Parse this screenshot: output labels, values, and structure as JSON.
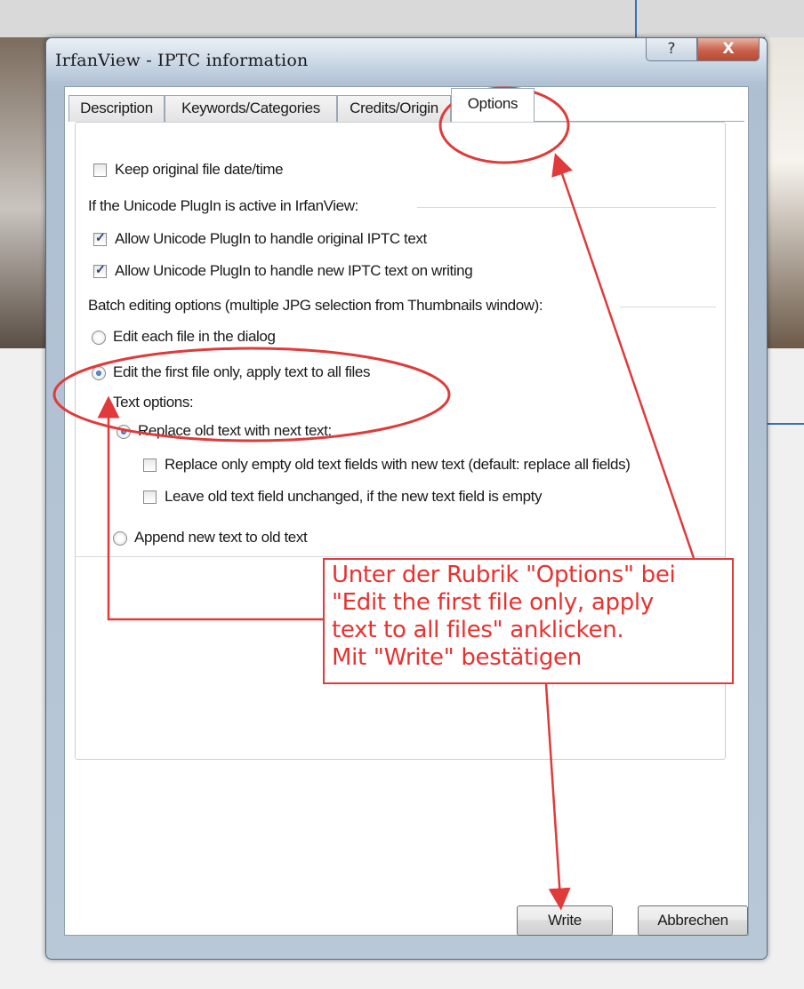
{
  "window": {
    "title": "IrfanView - IPTC information",
    "help_label": "?",
    "close_label": "X"
  },
  "tabs": [
    {
      "label": "Description"
    },
    {
      "label": "Keywords/Categories"
    },
    {
      "label": "Credits/Origin"
    },
    {
      "label": "Options",
      "active": true
    }
  ],
  "options": {
    "keep_date": {
      "label": "Keep original file date/time",
      "checked": false
    },
    "unicode_header": "If the Unicode PlugIn is active in IrfanView:",
    "unicode_original": {
      "label": "Allow Unicode PlugIn to handle original IPTC text",
      "checked": true
    },
    "unicode_new": {
      "label": "Allow Unicode PlugIn to handle new IPTC text on writing",
      "checked": true
    },
    "batch_header": "Batch editing options (multiple JPG selection from Thumbnails window):",
    "edit_each": {
      "label": "Edit each file in the dialog",
      "checked": false
    },
    "edit_first": {
      "label": "Edit the first file only, apply text to all files",
      "checked": true
    },
    "text_options_label": "Text options:",
    "replace_old": {
      "label": "Replace old text with next text:",
      "checked": true
    },
    "replace_empty": {
      "label": "Replace only empty old text fields with new text (default: replace all fields)",
      "checked": false
    },
    "leave_unchanged": {
      "label": "Leave old text field unchanged, if the new text field is empty",
      "checked": false
    },
    "append": {
      "label": "Append new text to old text",
      "checked": false
    }
  },
  "buttons": {
    "write": "Write",
    "cancel": "Abbrechen"
  },
  "annotation": {
    "lines": [
      "Unter der Rubrik \"Options\" bei",
      "\"Edit the first file only, apply",
      "text to all files\" anklicken.",
      "Mit \"Write\" bestätigen"
    ],
    "color": "#e8322f"
  },
  "colors": {
    "accent_red": "#e03a3a",
    "window_frame": "#b6c8db",
    "desktop_line": "#3b6fb3"
  }
}
